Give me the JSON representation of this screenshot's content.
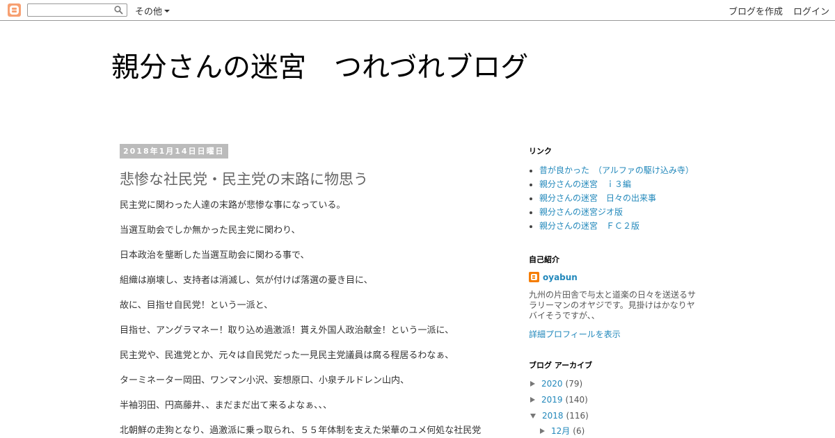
{
  "navbar": {
    "more_label": "その他",
    "create_blog": "ブログを作成",
    "login": "ログイン",
    "icons": [
      "blogger-logo-icon",
      "search-icon",
      "chevron-down-icon"
    ]
  },
  "header": {
    "blog_title": "親分さんの迷宮　つれづれブログ"
  },
  "post": {
    "date": "2018年1月14日日曜日",
    "title": "悲惨な社民党・民主党の末路に物思う",
    "paragraphs": [
      "民主党に関わった人達の末路が悲惨な事になっている。",
      "当選互助会でしか無かった民主党に関わり、",
      "日本政治を壟断した当選互助会に関わる事で、",
      "組織は崩壊し、支持者は消滅し、気が付けば落選の憂き目に、",
      "故に、目指せ自民党！という一派と、",
      "目指せ、アングラマネー！取り込め過激派！貰え外国人政治献金！という一派に、",
      "民主党や、民進党とか、元々は自民党だった一見民主党議員は腐る程居るわなぁ、",
      "ターミネーター岡田、ワンマン小沢、妄想原口、小泉チルドレン山内、",
      "半袖羽田、円高藤井、、まだまだ出て来るよなぁ、、、",
      "北朝鮮の走狗となり、過激派に乗っ取られ、５５年体制を支えた栄華のユメ何処な社民党"
    ]
  },
  "sidebar": {
    "links_heading": "リンク",
    "links": [
      "昔が良かった　（アルファの駆け込み寺）",
      "親分さんの迷宮　ｉ３編",
      "親分さんの迷宮　日々の出来事",
      "親分さんの迷宮ジオ版",
      "親分さんの迷宮　ＦＣ２版"
    ],
    "profile_heading": "自己紹介",
    "profile_name": "oyabun",
    "profile_desc": "九州の片田舎で与太と道楽の日々を送送るサラリーマンのオヤジです。見掛けはかなりヤバイそうですが、、",
    "profile_link": "詳細プロフィールを表示",
    "archive_heading": "ブログ アーカイブ",
    "archive": [
      {
        "label": "2020",
        "count": "(79)",
        "expanded": false
      },
      {
        "label": "2019",
        "count": "(140)",
        "expanded": false
      },
      {
        "label": "2018",
        "count": "(116)",
        "expanded": true
      },
      {
        "label": "12月",
        "count": "(6)",
        "expanded": false
      }
    ]
  }
}
